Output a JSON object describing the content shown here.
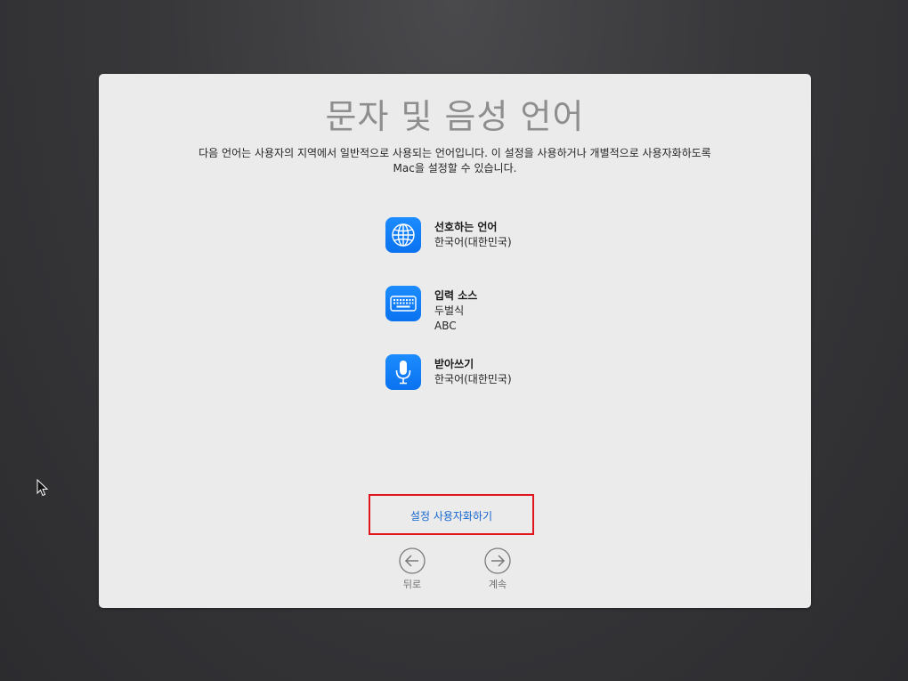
{
  "page": {
    "title": "문자 및 음성 언어",
    "description_line1": "다음 언어는 사용자의 지역에서 일반적으로 사용되는 언어입니다. 이 설정을 사용하거나 개별적으로 사용자화하도록",
    "description_line2": "Mac을 설정할 수 있습니다."
  },
  "settings": [
    {
      "icon": "globe-icon",
      "heading": "선호하는 언어",
      "values": [
        "한국어(대한민국)"
      ]
    },
    {
      "icon": "keyboard-icon",
      "heading": "입력 소스",
      "values": [
        "두벌식",
        "ABC"
      ]
    },
    {
      "icon": "microphone-icon",
      "heading": "받아쓰기",
      "values": [
        "한국어(대한민국)"
      ]
    }
  ],
  "customize_label": "설정 사용자화하기",
  "navigation": {
    "back_label": "뒤로",
    "continue_label": "계속"
  },
  "colors": {
    "accent": "#0a72f0",
    "link": "#1566d0",
    "highlight_box": "#e0141c",
    "panel_background": "#ebebeb"
  }
}
